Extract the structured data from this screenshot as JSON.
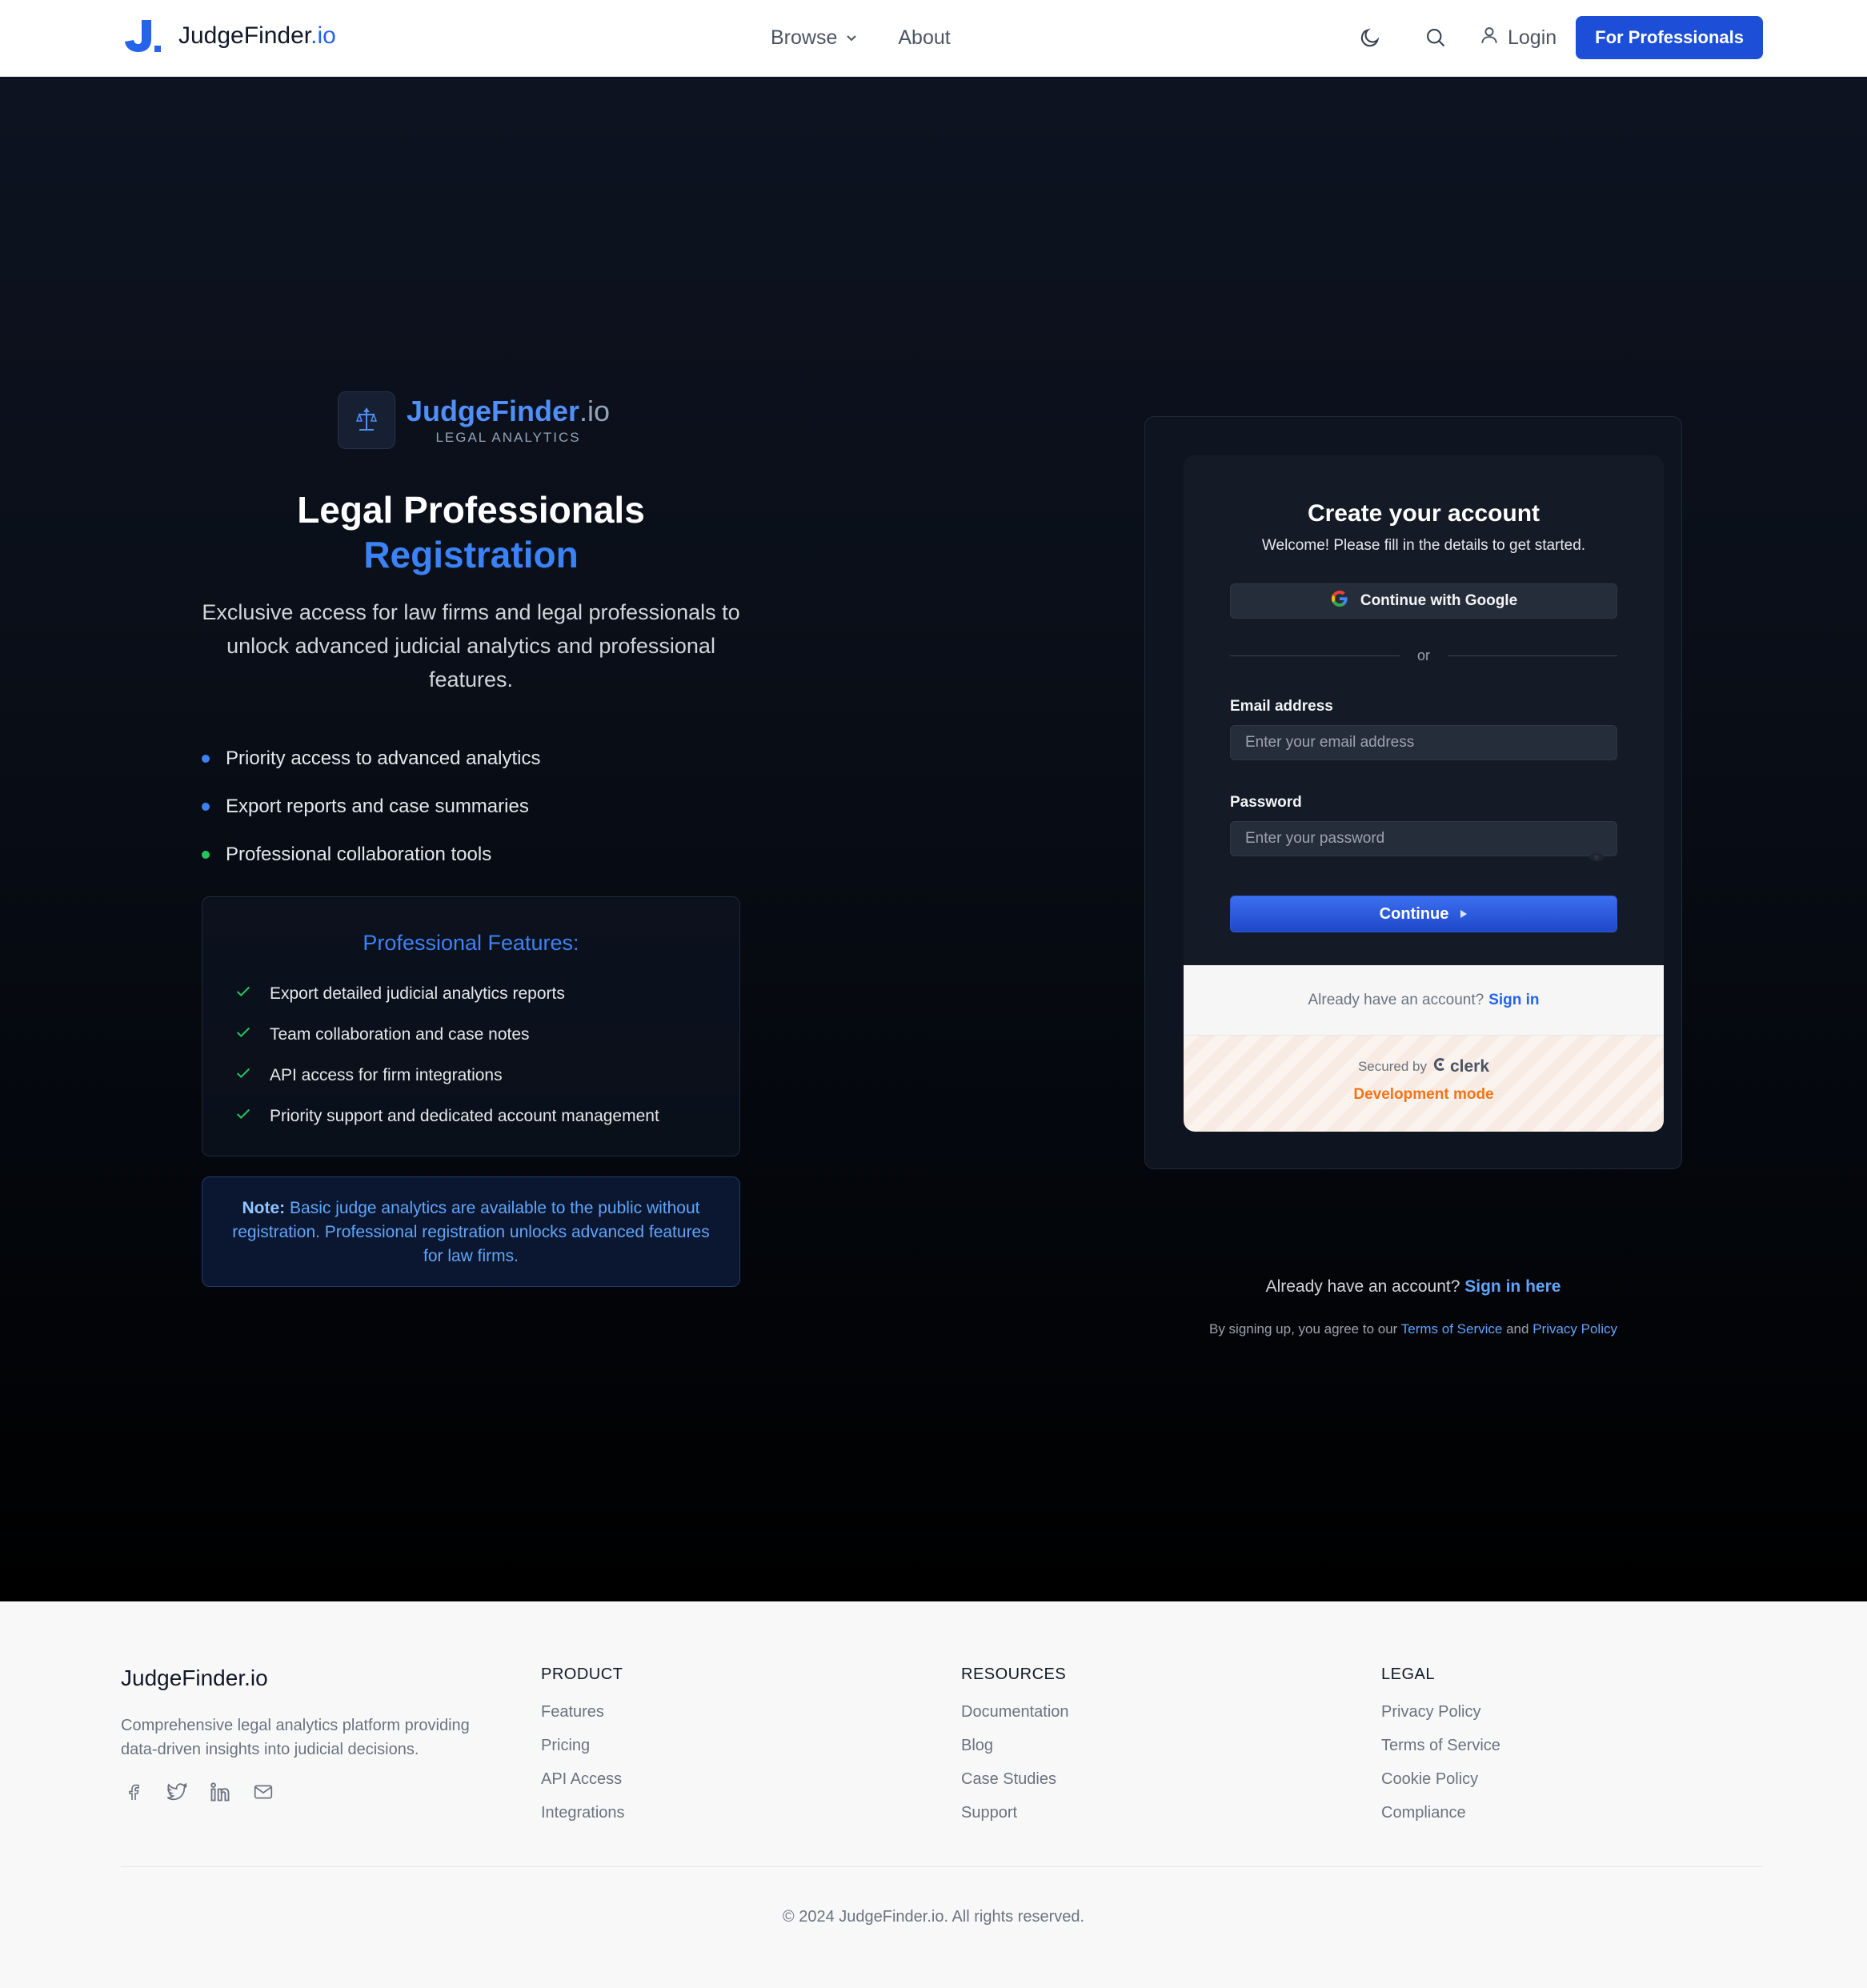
{
  "header": {
    "brand_name": "JudgeFinder",
    "brand_tld": ".io",
    "nav": {
      "browse": "Browse",
      "about": "About"
    },
    "login": "Login",
    "pro_button": "For Professionals"
  },
  "hero": {
    "logo_name": "JudgeFinder",
    "logo_tld": ".io",
    "logo_tagline": "LEGAL ANALYTICS",
    "title_line1": "Legal Professionals",
    "title_line2": "Registration",
    "description": "Exclusive access for law firms and legal professionals to unlock advanced judicial analytics and professional features.",
    "bullets": [
      {
        "text": "Priority access to advanced analytics",
        "color": "#3b82f6"
      },
      {
        "text": "Export reports and case summaries",
        "color": "#3b82f6"
      },
      {
        "text": "Professional collaboration tools",
        "color": "#22c55e"
      }
    ],
    "features_title": "Professional Features:",
    "features": [
      "Export detailed judicial analytics reports",
      "Team collaboration and case notes",
      "API access for firm integrations",
      "Priority support and dedicated account management"
    ],
    "note_label": "Note:",
    "note_text": "Basic judge analytics are available to the public without registration. Professional registration unlocks advanced features for law firms."
  },
  "signup": {
    "title": "Create your account",
    "subtitle": "Welcome! Please fill in the details to get started.",
    "google_button": "Continue with Google",
    "divider": "or",
    "email_label": "Email address",
    "email_placeholder": "Enter your email address",
    "email_value": "",
    "password_label": "Password",
    "password_placeholder": "Enter your password",
    "password_value": "",
    "continue_button": "Continue",
    "footer_question": "Already have an account?",
    "footer_link": "Sign in",
    "secured_by": "Secured by",
    "clerk_brand": "clerk",
    "dev_mode": "Development mode",
    "below_question": "Already have an account?",
    "below_link": "Sign in here",
    "terms_prefix": "By signing up, you agree to our",
    "terms_link": "Terms of Service",
    "terms_and": "and",
    "privacy_link": "Privacy Policy"
  },
  "footer": {
    "brand": "JudgeFinder.io",
    "description": "Comprehensive legal analytics platform providing data-driven insights into judicial decisions.",
    "columns": [
      {
        "title": "PRODUCT",
        "links": [
          "Features",
          "Pricing",
          "API Access",
          "Integrations"
        ]
      },
      {
        "title": "RESOURCES",
        "links": [
          "Documentation",
          "Blog",
          "Case Studies",
          "Support"
        ]
      },
      {
        "title": "LEGAL",
        "links": [
          "Privacy Policy",
          "Terms of Service",
          "Cookie Policy",
          "Compliance"
        ]
      }
    ],
    "social_icons": [
      "facebook-icon",
      "twitter-icon",
      "linkedin-icon",
      "mail-icon"
    ],
    "copyright": "© 2024 JudgeFinder.io. All rights reserved."
  }
}
